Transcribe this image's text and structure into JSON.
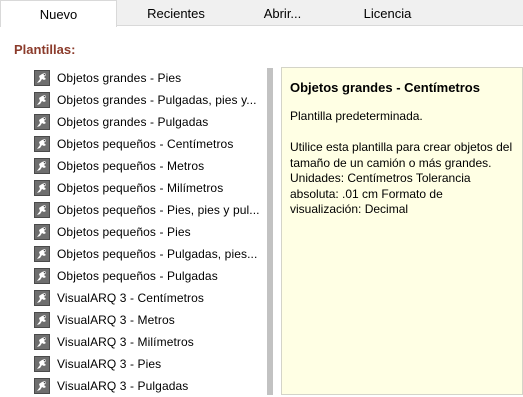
{
  "tabs": [
    {
      "label": "Nuevo",
      "active": true
    },
    {
      "label": "Recientes",
      "active": false
    },
    {
      "label": "Abrir...",
      "active": false
    },
    {
      "label": "Licencia",
      "active": false
    }
  ],
  "section": {
    "heading": "Plantillas:"
  },
  "templates": [
    {
      "label": "Objetos grandes - Pies",
      "icon": "rhino-template-icon"
    },
    {
      "label": "Objetos grandes - Pulgadas, pies y...",
      "icon": "rhino-template-icon"
    },
    {
      "label": "Objetos grandes - Pulgadas",
      "icon": "rhino-template-icon"
    },
    {
      "label": "Objetos pequeños - Centímetros",
      "icon": "rhino-template-icon"
    },
    {
      "label": "Objetos pequeños - Metros",
      "icon": "rhino-template-icon"
    },
    {
      "label": "Objetos pequeños - Milímetros",
      "icon": "rhino-template-icon"
    },
    {
      "label": "Objetos pequeños - Pies, pies y pul...",
      "icon": "rhino-template-icon"
    },
    {
      "label": "Objetos pequeños - Pies",
      "icon": "rhino-template-icon"
    },
    {
      "label": "Objetos pequeños - Pulgadas, pies...",
      "icon": "rhino-template-icon"
    },
    {
      "label": "Objetos pequeños - Pulgadas",
      "icon": "rhino-template-icon"
    },
    {
      "label": "VisualARQ 3 - Centímetros",
      "icon": "rhino-template-icon"
    },
    {
      "label": "VisualARQ 3 - Metros",
      "icon": "rhino-template-icon"
    },
    {
      "label": "VisualARQ 3 - Milímetros",
      "icon": "rhino-template-icon"
    },
    {
      "label": "VisualARQ 3 - Pies",
      "icon": "rhino-template-icon"
    },
    {
      "label": "VisualARQ 3 - Pulgadas",
      "icon": "rhino-template-icon"
    }
  ],
  "description": {
    "title": "Objetos grandes - Centímetros",
    "subtitle": "Plantilla predeterminada.",
    "body": "Utilice esta plantilla para crear objetos del tamaño de un camión o más grandes. Unidades: Centímetros Tolerancia absoluta: .01 cm Formato de visualización: Decimal"
  },
  "colors": {
    "heading": "#8b3b2b",
    "panel_background": "#ffffe4",
    "tab_strip": "#f0f0f0"
  }
}
